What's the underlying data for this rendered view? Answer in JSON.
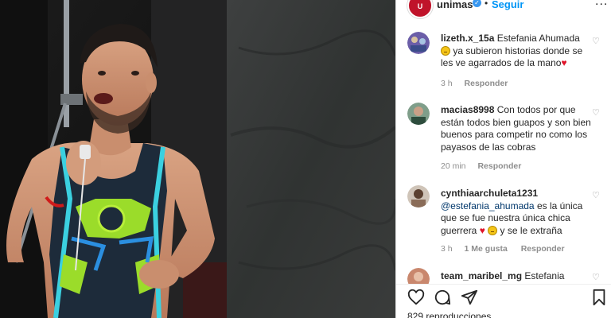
{
  "header": {
    "username": "unimas",
    "follow_label": "Seguir",
    "separator": "•",
    "more": "...",
    "logo_text": "U"
  },
  "comments": [
    {
      "username": "lizeth.x_15a",
      "mention": "Estefania Ahumada",
      "text_after_emoji": "ya subieron historias donde se les ve agarrados de la mano",
      "time": "3 h",
      "reply": "Responder"
    },
    {
      "username": "macias8998",
      "text": "Con todos por que están todos bien guapos y son bien buenos para competir no como los payasos de las cobras",
      "time": "20 min",
      "reply": "Responder"
    },
    {
      "username": "cynthiaarchuleta1231",
      "mention": "@estefania_ahumada",
      "text": "es la única que se fue nuestra única chica guerrera",
      "text_end": "y se le extraña",
      "time": "3 h",
      "likes": "1 Me gusta",
      "reply": "Responder"
    },
    {
      "username": "team_maribel_mg",
      "text": "Estefania"
    }
  ],
  "footer": {
    "views": "829 reproducciones"
  },
  "icons": {
    "like": "heart-icon",
    "comment": "comment-icon",
    "share": "paper-plane-icon",
    "save": "bookmark-icon",
    "verified": "verified-badge-icon"
  },
  "colors": {
    "link_blue": "#0095f6",
    "verified_blue": "#3897f0",
    "brand_red": "#c0132a",
    "meta_gray": "#8e8e8e",
    "heart_red": "#e0142a"
  }
}
